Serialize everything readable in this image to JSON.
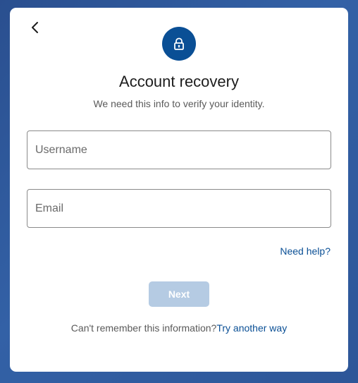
{
  "header": {
    "back_icon": "chevron-left-icon",
    "lock_icon": "lock-icon",
    "title": "Account recovery",
    "subtitle": "We need this info to verify your identity."
  },
  "form": {
    "username_placeholder": "Username",
    "email_placeholder": "Email",
    "username_value": "",
    "email_value": ""
  },
  "links": {
    "need_help": "Need help?",
    "cant_remember": "Can't remember this information?",
    "try_another_way": "Try another way"
  },
  "actions": {
    "next_label": "Next"
  },
  "colors": {
    "accent": "#0a4f95",
    "next_disabled": "#b5cbe3",
    "background": "#2f5a9c"
  }
}
